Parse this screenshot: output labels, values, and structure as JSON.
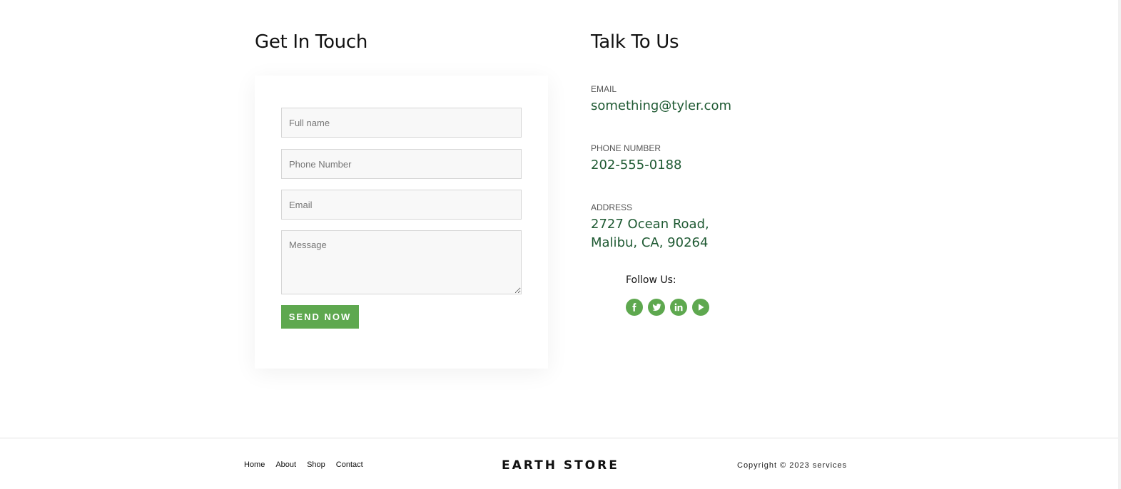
{
  "contact_form": {
    "heading": "Get In Touch",
    "full_name_placeholder": "Full name",
    "phone_placeholder": "Phone Number",
    "email_placeholder": "Email",
    "message_placeholder": "Message",
    "submit_label": "SEND NOW"
  },
  "contact_info": {
    "heading": "Talk To Us",
    "email_label": "EMAIL",
    "email_value": "something@tyler.com",
    "phone_label": "PHONE NUMBER",
    "phone_value": "202-555-0188",
    "address_label": "ADDRESS",
    "address_line1": "2727 Ocean Road,",
    "address_line2": "Malibu, CA, 90264",
    "follow_label": "Follow Us:",
    "social_icons": [
      "facebook-icon",
      "twitter-icon",
      "linkedin-icon",
      "youtube-icon"
    ],
    "accent_color": "#5ea84f",
    "value_color": "#1f5a33"
  },
  "footer": {
    "nav": [
      "Home",
      "About",
      "Shop",
      "Contact"
    ],
    "brand": "EARTH STORE",
    "copyright": "Copyright © 2023 services"
  }
}
